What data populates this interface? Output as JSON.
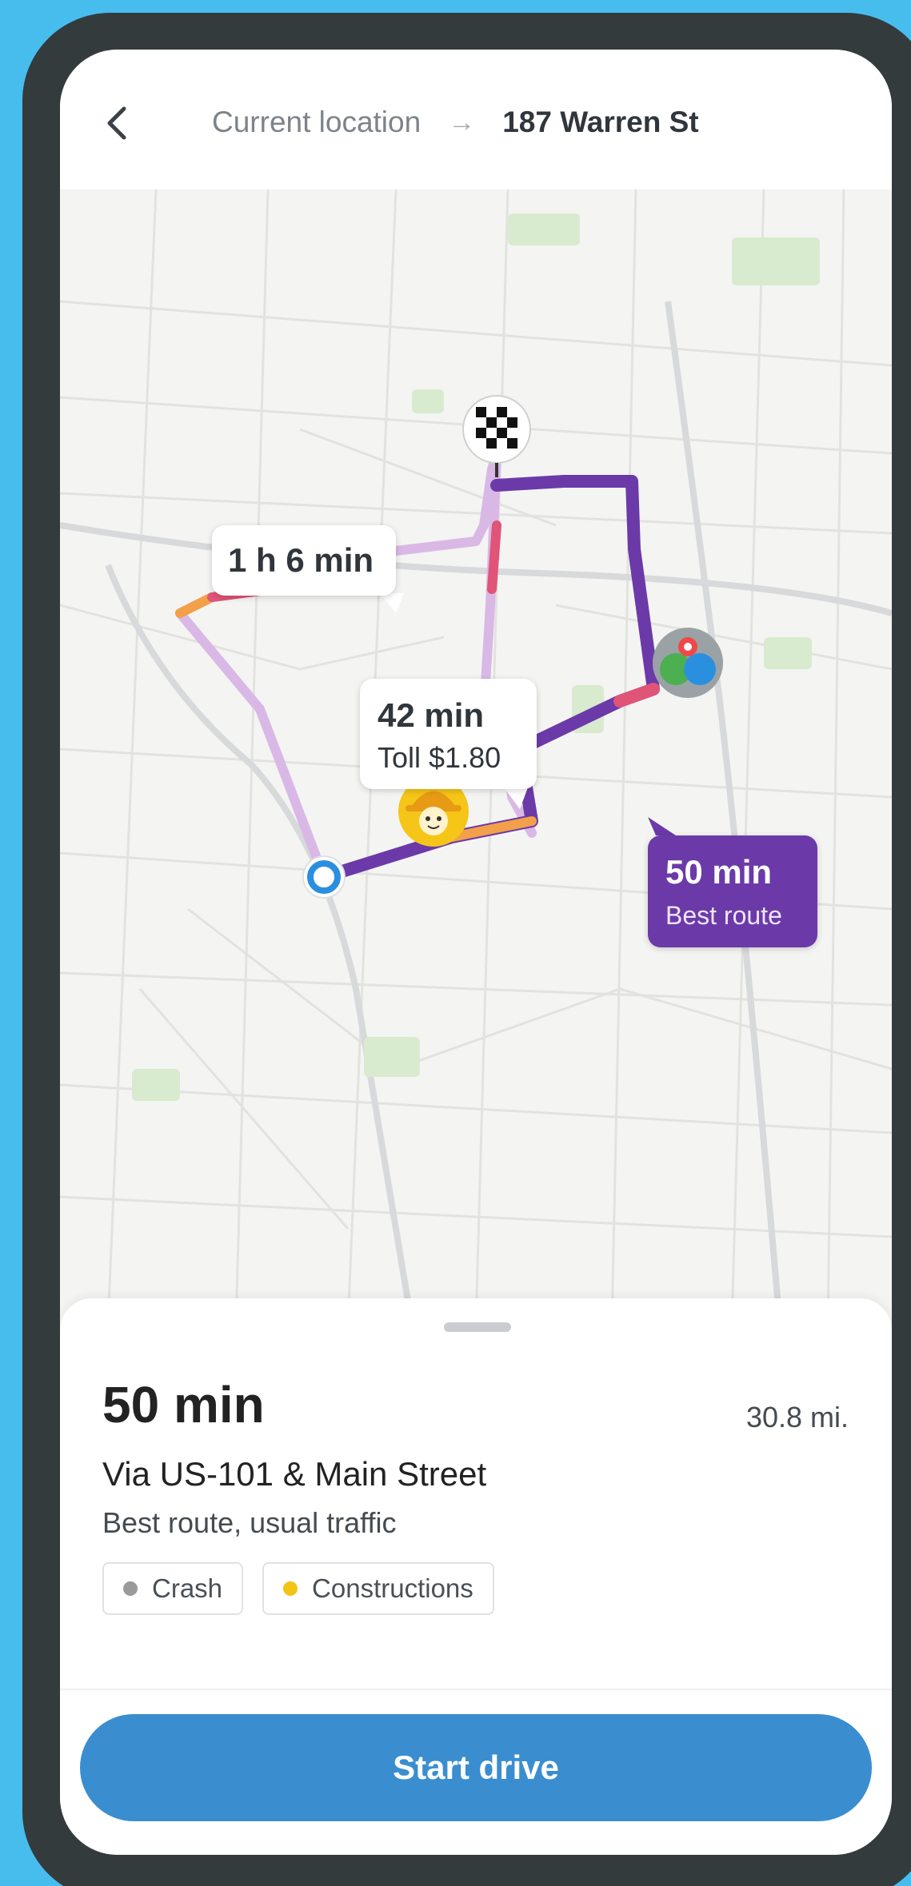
{
  "header": {
    "from": "Current location",
    "arrow": "→",
    "to": "187 Warren St"
  },
  "map": {
    "routes": [
      {
        "time": "1 h 6 min"
      },
      {
        "time": "42 min",
        "toll": "Toll $1.80"
      },
      {
        "time": "50 min",
        "label": "Best route"
      }
    ],
    "markers": [
      "destination-flag-icon",
      "construction-worker-icon",
      "crash-icon",
      "current-location-icon"
    ],
    "colors": {
      "best_route": "#6b3aa8",
      "alt_route": "#d9b8e6",
      "heavy_traffic": "#e05478",
      "moderate_traffic": "#f3a04a",
      "brand": "#3a8ed0"
    }
  },
  "sheet": {
    "time": "50 min",
    "distance": "30.8 mi.",
    "via": "Via US-101 & Main Street",
    "description": "Best route, usual traffic",
    "tags": [
      {
        "label": "Crash",
        "color": "#9a9a9a"
      },
      {
        "label": "Constructions",
        "color": "#f3c416"
      }
    ]
  },
  "footer": {
    "start_label": "Start drive"
  }
}
